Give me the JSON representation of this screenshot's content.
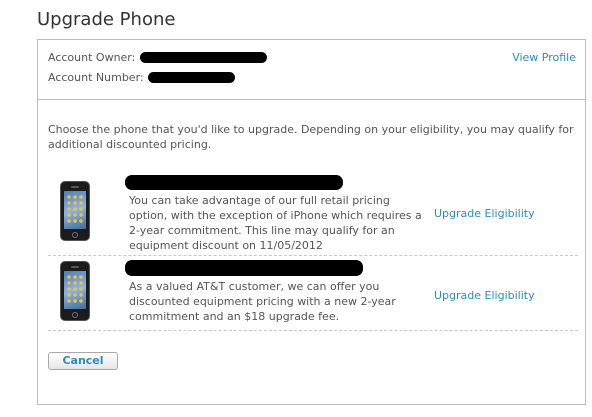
{
  "page": {
    "title": "Upgrade Phone"
  },
  "account": {
    "owner_label": "Account Owner:",
    "number_label": "Account Number:",
    "view_profile_label": "View Profile"
  },
  "intro_text": "Choose the phone that you'd like to upgrade. Depending on your eligibility, you may qualify for additional discounted pricing.",
  "lines": [
    {
      "description": "You can take advantage of our full retail pricing option, with the exception of iPhone which requires a 2-year commitment. This line may qualify for an equipment discount on 11/05/2012",
      "link_label": "Upgrade Eligibility",
      "phone_icon": "iphone-icon"
    },
    {
      "description": "As a valued AT&T customer, we can offer you discounted equipment pricing with a new 2-year commitment and an $18 upgrade fee.",
      "link_label": "Upgrade Eligibility",
      "phone_icon": "iphone-icon"
    }
  ],
  "actions": {
    "cancel_label": "Cancel"
  },
  "colors": {
    "link": "#2a8dbf",
    "border": "#bdbdbd",
    "text": "#555555",
    "redaction": "#000000"
  }
}
